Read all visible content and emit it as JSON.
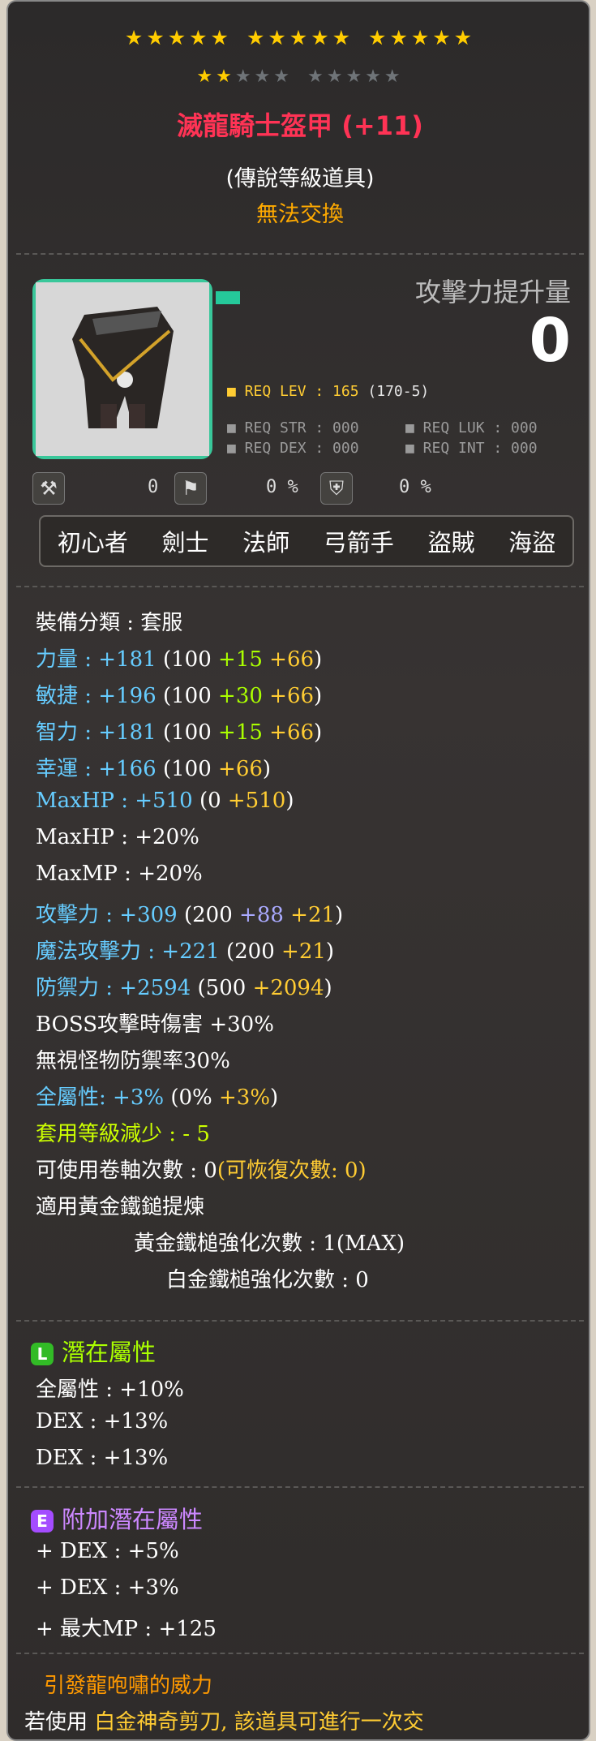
{
  "stars": {
    "row1": [
      "★★★★★",
      "★★★★★",
      "★★★★★"
    ],
    "row2_on": "★★",
    "row2_off1": "★★★",
    "row2_off2": "★★★★★"
  },
  "item": {
    "name": "滅龍騎士盔甲 (+11)",
    "grade": "(傳說等級道具)",
    "trade": "無法交換"
  },
  "attack_boost": {
    "label": "攻擊力提升量",
    "value": "0"
  },
  "requirements": {
    "lev_label": "■ REQ LEV : 165",
    "lev_sub": "(170-5)",
    "str": "■ REQ STR : 000",
    "luk": "■ REQ LUK : 000",
    "dex": "■ REQ DEX : 000",
    "int": "■ REQ INT : 000"
  },
  "icons": {
    "v1": "0",
    "v2": "0 %",
    "v3": "0 %"
  },
  "jobs": [
    "初心者",
    "劍士",
    "法師",
    "弓箭手",
    "盜賊",
    "海盜"
  ],
  "stats": {
    "category": "裝備分類 : 套服",
    "str": {
      "label": "力量 : ",
      "total": "+181",
      "base": "(100 ",
      "a": "+15",
      "b": " +66",
      "end": ")"
    },
    "dex": {
      "label": "敏捷 : ",
      "total": "+196",
      "base": "(100 ",
      "a": "+30",
      "b": " +66",
      "end": ")"
    },
    "int": {
      "label": "智力 : ",
      "total": "+181",
      "base": "(100 ",
      "a": "+15",
      "b": " +66",
      "end": ")"
    },
    "luk": {
      "label": "幸運 : ",
      "total": "+166",
      "base": "(100 ",
      "b": "+66",
      "end": ")"
    },
    "maxhp": {
      "label": "MaxHP : ",
      "total": "+510",
      "base": "(0 ",
      "b": "+510",
      "end": ")"
    },
    "maxhp_pct": "MaxHP : +20%",
    "maxmp_pct": "MaxMP : +20%",
    "atk": {
      "label": "攻擊力 : ",
      "total": "+309",
      "base": "(200 ",
      "star": "+88",
      "b": " +21",
      "end": ")"
    },
    "matk": {
      "label": "魔法攻擊力 : ",
      "total": "+221",
      "base": "(200 ",
      "b": "+21",
      "end": ")"
    },
    "def": {
      "label": "防禦力 : ",
      "total": "+2594",
      "base": "(500 ",
      "b": "+2094",
      "end": ")"
    },
    "boss": "BOSS攻擊時傷害 +30%",
    "ignore": "無視怪物防禦率30%",
    "allstat": {
      "label": "全屬性: ",
      "total": "+3%",
      "base": "(0% ",
      "b": "+3%",
      "end": ")"
    },
    "lvreduce": "套用等級減少 : - 5",
    "scroll": {
      "label": "可使用卷軸次數 : 0",
      "restore": "(可恢復次數: 0)"
    },
    "golden_hammer": "適用黃金鐵鎚提煉",
    "golden_count": "黃金鐵槌強化次數 : 1(MAX)",
    "platinum_count": "白金鐵槌強化次數 : 0"
  },
  "potential": {
    "title": "潛在屬性",
    "badge": "L",
    "lines": [
      "全屬性 : +10%",
      "DEX : +13%",
      "DEX : +13%"
    ]
  },
  "additional": {
    "title": "附加潛在屬性",
    "badge": "E",
    "lines": [
      "+ DEX : +5%",
      "+ DEX : +3%",
      "+ 最大MP : +125"
    ]
  },
  "footer": {
    "title": "引發龍咆嘯的威力",
    "text_a": "若使用 ",
    "text_b": "白金神奇剪刀, 該道具可進行一次交"
  },
  "colors": {
    "accent_green": "#39c79a",
    "title_red": "#ff3355",
    "star_gold": "#ffcc00"
  }
}
